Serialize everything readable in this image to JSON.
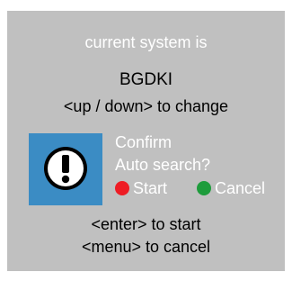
{
  "header": {
    "title": "current system is"
  },
  "system": {
    "name": "BGDKI",
    "change_hint": "<up / down> to change"
  },
  "dialog": {
    "icon": "exclamation-icon",
    "title": "Confirm",
    "question": "Auto search?",
    "start_label": "Start",
    "cancel_label": "Cancel"
  },
  "footer": {
    "enter_hint": "<enter> to start",
    "menu_hint": "<menu> to cancel"
  },
  "colors": {
    "screen_background": "#c0c0c0",
    "icon_background": "#3b8cc4",
    "start_dot": "#ee1c24",
    "cancel_dot": "#1e9c3c"
  }
}
